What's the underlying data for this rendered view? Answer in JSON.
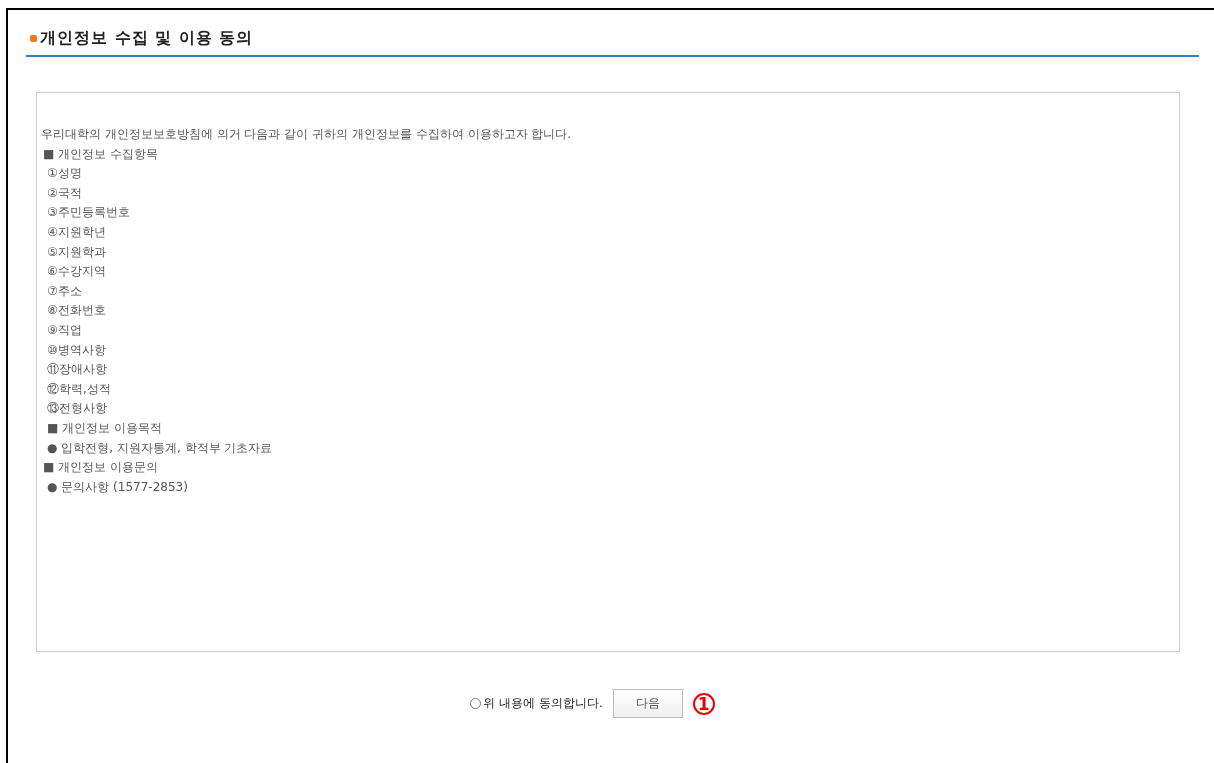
{
  "title": "개인정보 수집 및 이용 동의",
  "lines": [
    {
      "kind": "intro",
      "text": "우리대학의 개인정보보호방침에 의거 다음과 같이 귀하의 개인정보를 수집하여 이용하고자 합니다."
    },
    {
      "kind": "heading",
      "text": "■ 개인정보 수집항목"
    },
    {
      "kind": "item",
      "text": "①성명"
    },
    {
      "kind": "item",
      "text": "②국적"
    },
    {
      "kind": "item",
      "text": "③주민등록번호"
    },
    {
      "kind": "item",
      "text": "④지원학년"
    },
    {
      "kind": "item",
      "text": "⑤지원학과"
    },
    {
      "kind": "item",
      "text": "⑥수강지역"
    },
    {
      "kind": "item",
      "text": "⑦주소"
    },
    {
      "kind": "item",
      "text": "⑧전화번호"
    },
    {
      "kind": "item",
      "text": "⑨직업"
    },
    {
      "kind": "item",
      "text": "⑩병역사항"
    },
    {
      "kind": "item",
      "text": "⑪장애사항"
    },
    {
      "kind": "item",
      "text": "⑫학력,성적"
    },
    {
      "kind": "item",
      "text": "⑬전형사항"
    },
    {
      "kind": "item",
      "text": "■ 개인정보 이용목적"
    },
    {
      "kind": "item",
      "text": "● 입학전형, 지원자통계, 학적부 기초자료"
    },
    {
      "kind": "heading",
      "text": "■ 개인정보 이용문의"
    },
    {
      "kind": "item",
      "text": "● 문의사항 (1577-2853)"
    }
  ],
  "agree": {
    "label": "위 내용에 동의합니다.",
    "checked": false
  },
  "next_button": "다음",
  "annotation": "1"
}
